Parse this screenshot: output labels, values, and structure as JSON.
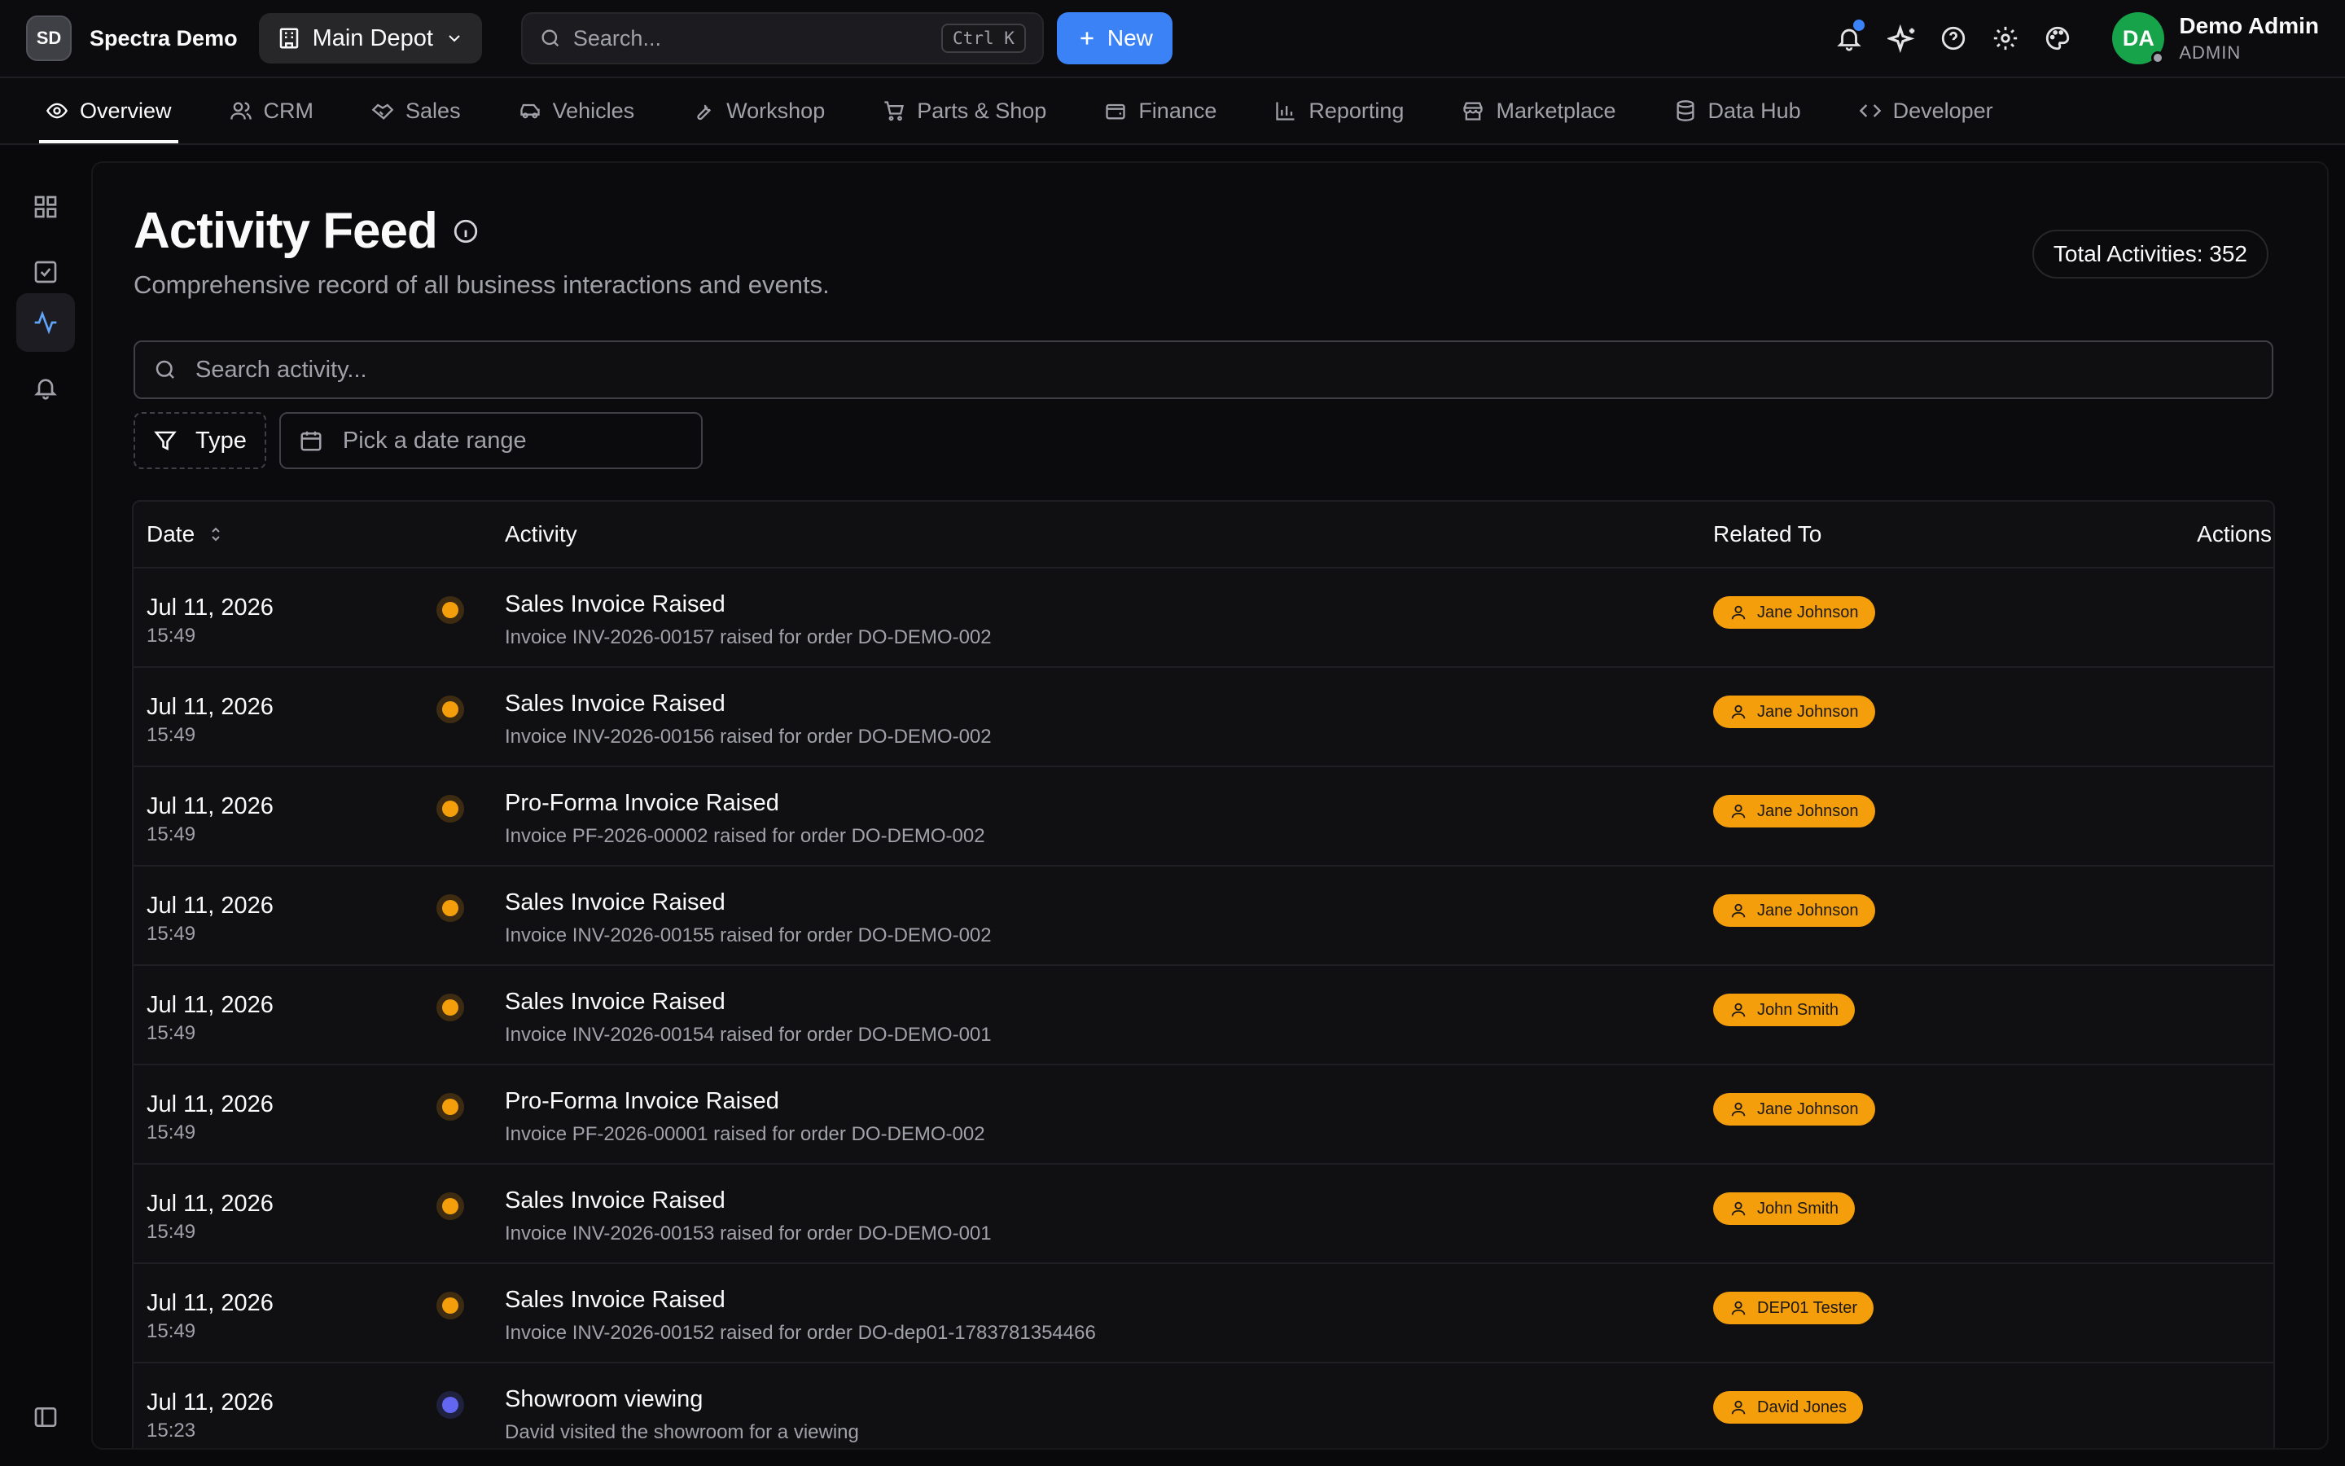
{
  "org": {
    "initials": "SD",
    "name": "Spectra Demo"
  },
  "depot": {
    "label": "Main Depot"
  },
  "search": {
    "placeholder": "Search...",
    "shortcut": "Ctrl K"
  },
  "new_button": {
    "label": "New"
  },
  "user": {
    "initials": "DA",
    "name": "Demo Admin",
    "role": "ADMIN"
  },
  "nav": {
    "items": [
      {
        "label": "Overview",
        "icon": "eye-icon"
      },
      {
        "label": "CRM",
        "icon": "users-icon"
      },
      {
        "label": "Sales",
        "icon": "handshake-icon"
      },
      {
        "label": "Vehicles",
        "icon": "car-icon"
      },
      {
        "label": "Workshop",
        "icon": "wrench-icon"
      },
      {
        "label": "Parts & Shop",
        "icon": "cart-icon"
      },
      {
        "label": "Finance",
        "icon": "wallet-icon"
      },
      {
        "label": "Reporting",
        "icon": "bar-chart-icon"
      },
      {
        "label": "Marketplace",
        "icon": "store-icon"
      },
      {
        "label": "Data Hub",
        "icon": "database-icon"
      },
      {
        "label": "Developer",
        "icon": "code-icon"
      }
    ]
  },
  "page": {
    "title": "Activity Feed",
    "subtitle": "Comprehensive record of all business interactions and events.",
    "total_label": "Total Activities: 352",
    "search_placeholder": "Search activity...",
    "type_filter": "Type",
    "date_placeholder": "Pick a date range"
  },
  "table": {
    "columns": {
      "date": "Date",
      "activity": "Activity",
      "related": "Related To",
      "actions": "Actions"
    },
    "rows": [
      {
        "date": "Jul 11, 2026",
        "time": "15:49",
        "title": "Sales Invoice Raised",
        "desc": "Invoice INV-2026-00157 raised for order DO-DEMO-002",
        "related": "Jane Johnson",
        "dot_color": "#f59e0b"
      },
      {
        "date": "Jul 11, 2026",
        "time": "15:49",
        "title": "Sales Invoice Raised",
        "desc": "Invoice INV-2026-00156 raised for order DO-DEMO-002",
        "related": "Jane Johnson",
        "dot_color": "#f59e0b"
      },
      {
        "date": "Jul 11, 2026",
        "time": "15:49",
        "title": "Pro-Forma Invoice Raised",
        "desc": "Invoice PF-2026-00002 raised for order DO-DEMO-002",
        "related": "Jane Johnson",
        "dot_color": "#f59e0b"
      },
      {
        "date": "Jul 11, 2026",
        "time": "15:49",
        "title": "Sales Invoice Raised",
        "desc": "Invoice INV-2026-00155 raised for order DO-DEMO-002",
        "related": "Jane Johnson",
        "dot_color": "#f59e0b"
      },
      {
        "date": "Jul 11, 2026",
        "time": "15:49",
        "title": "Sales Invoice Raised",
        "desc": "Invoice INV-2026-00154 raised for order DO-DEMO-001",
        "related": "John Smith",
        "dot_color": "#f59e0b"
      },
      {
        "date": "Jul 11, 2026",
        "time": "15:49",
        "title": "Pro-Forma Invoice Raised",
        "desc": "Invoice PF-2026-00001 raised for order DO-DEMO-002",
        "related": "Jane Johnson",
        "dot_color": "#f59e0b"
      },
      {
        "date": "Jul 11, 2026",
        "time": "15:49",
        "title": "Sales Invoice Raised",
        "desc": "Invoice INV-2026-00153 raised for order DO-DEMO-001",
        "related": "John Smith",
        "dot_color": "#f59e0b"
      },
      {
        "date": "Jul 11, 2026",
        "time": "15:49",
        "title": "Sales Invoice Raised",
        "desc": "Invoice INV-2026-00152 raised for order DO-dep01-1783781354466",
        "related": "DEP01 Tester",
        "dot_color": "#f59e0b"
      },
      {
        "date": "Jul 11, 2026",
        "time": "15:23",
        "title": "Showroom viewing",
        "desc": "David visited the showroom for a viewing",
        "related": "David Jones",
        "dot_color": "#6366f1"
      }
    ]
  },
  "colors": {
    "accent": "#3b82f6",
    "chip": "#f59e0b",
    "avatar": "#16a34a"
  }
}
